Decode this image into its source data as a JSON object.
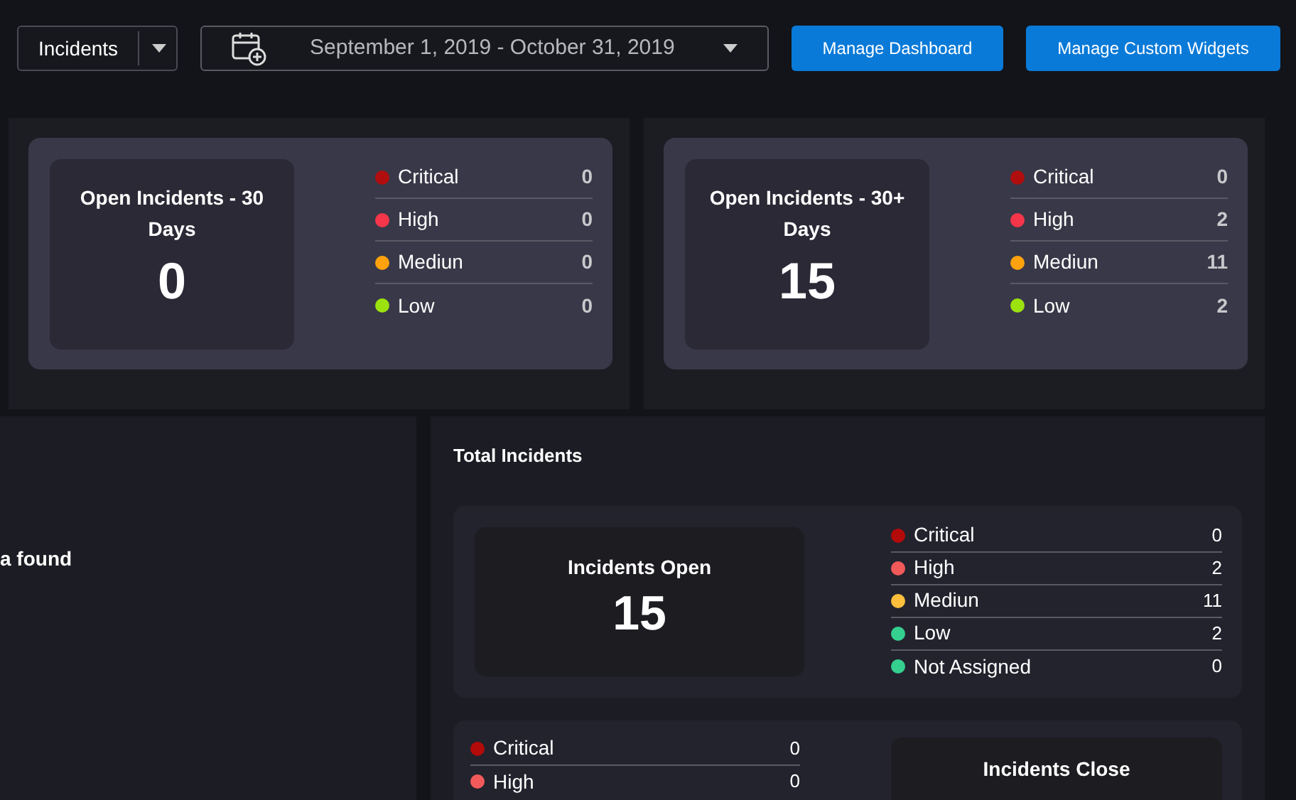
{
  "top_bar": {
    "module_select": {
      "value": "Incidents"
    },
    "date_range": {
      "value": "September 1, 2019 - October 31, 2019"
    },
    "buttons": [
      "Manage Dashboard",
      "Manage Custom Widgets"
    ]
  },
  "summary_cards": [
    {
      "title": "Open Incidents - 30 Days",
      "count": "0",
      "severities": [
        {
          "label": "Critical",
          "color": "#b00e0e",
          "value": "0"
        },
        {
          "label": "High",
          "color": "#f5364a",
          "value": "0"
        },
        {
          "label": "Mediun",
          "color": "#ffa20d",
          "value": "0"
        },
        {
          "label": "Low",
          "color": "#9be20f",
          "value": "0"
        }
      ]
    },
    {
      "title": "Open Incidents - 30+ Days",
      "count": "15",
      "severities": [
        {
          "label": "Critical",
          "color": "#b00e0e",
          "value": "0"
        },
        {
          "label": "High",
          "color": "#f5364a",
          "value": "2"
        },
        {
          "label": "Mediun",
          "color": "#ffa20d",
          "value": "11"
        },
        {
          "label": "Low",
          "color": "#9be20f",
          "value": "2"
        }
      ]
    }
  ],
  "no_data_panel": {
    "message": "a found"
  },
  "total_incidents": {
    "title": "Total Incidents",
    "open": {
      "title": "Incidents Open",
      "count": "15",
      "severities": [
        {
          "label": "Critical",
          "color": "#b30a0a",
          "value": "0"
        },
        {
          "label": "High",
          "color": "#f25a5a",
          "value": "2"
        },
        {
          "label": "Mediun",
          "color": "#fbbf3c",
          "value": "11"
        },
        {
          "label": "Low",
          "color": "#35d08f",
          "value": "2"
        },
        {
          "label": "Not Assigned",
          "color": "#35d08f",
          "value": "0"
        }
      ]
    },
    "closed": {
      "title": "Incidents Close",
      "severities": [
        {
          "label": "Critical",
          "color": "#b30a0a",
          "value": "0"
        },
        {
          "label": "High",
          "color": "#f25a5a",
          "value": "0"
        }
      ]
    }
  }
}
